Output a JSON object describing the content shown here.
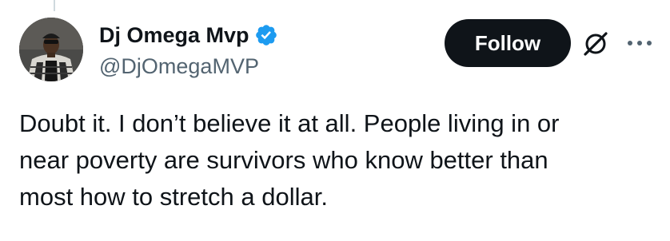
{
  "author": {
    "display_name": "Dj Omega Mvp",
    "handle": "@DjOmegaMVP",
    "verified": true,
    "verified_color": "#1d9bf0"
  },
  "actions": {
    "follow_label": "Follow",
    "grok_icon": "grok-icon",
    "more_icon": "more-horizontal-icon"
  },
  "tweet": {
    "lines": [
      "Doubt it. I don’t believe it at all. People living in or",
      "near poverty are survivors who know better than",
      "most how to stretch a dollar."
    ]
  },
  "colors": {
    "text": "#0f1419",
    "secondary": "#536471",
    "button_bg": "#0f1419",
    "button_text": "#ffffff"
  }
}
